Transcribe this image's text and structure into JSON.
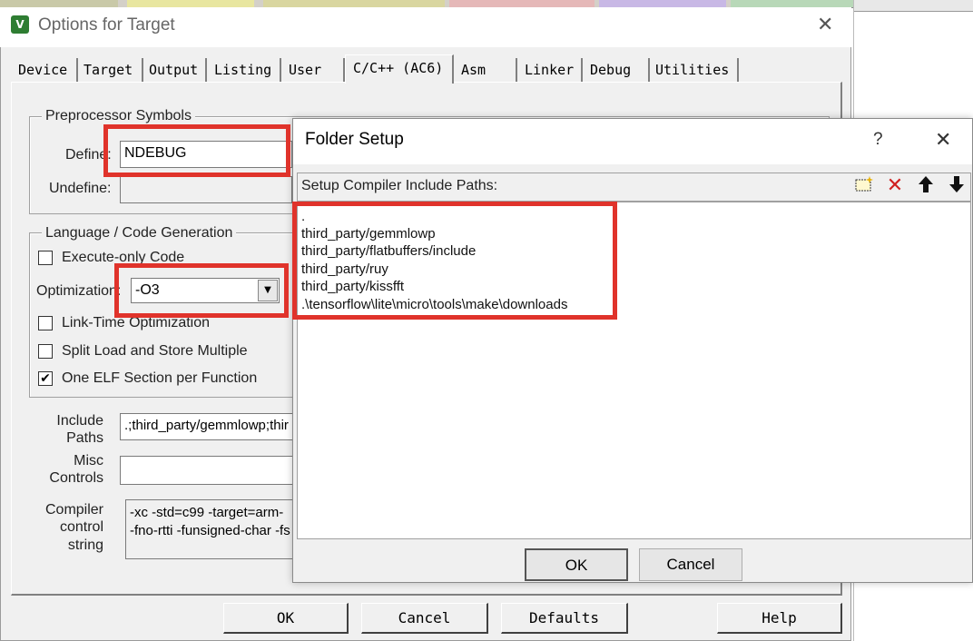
{
  "main_dialog": {
    "title": "Options for Target",
    "close_glyph": "✕",
    "tabs": [
      "Device",
      "Target",
      "Output",
      "Listing",
      "User",
      "C/C++ (AC6)",
      "Asm",
      "Linker",
      "Debug",
      "Utilities"
    ],
    "active_tab": "C/C++ (AC6)",
    "preprocessor": {
      "group_label": "Preprocessor Symbols",
      "define_label": "Define:",
      "define_value": "NDEBUG",
      "undefine_label": "Undefine:",
      "undefine_value": ""
    },
    "language": {
      "group_label": "Language / Code Generation",
      "execute_only": {
        "label": "Execute-only Code",
        "checked": false
      },
      "optimization_label": "Optimization:",
      "optimization_value": "-O3",
      "link_time": {
        "label": "Link-Time Optimization",
        "checked": false
      },
      "split_load": {
        "label": "Split Load and Store Multiple",
        "checked": false
      },
      "one_elf": {
        "label": "One ELF Section per Function",
        "checked": true
      }
    },
    "include_paths": {
      "label_1": "Include",
      "label_2": "Paths",
      "value": ".;third_party/gemmlowp;thir"
    },
    "misc_controls": {
      "label_1": "Misc",
      "label_2": "Controls",
      "value": ""
    },
    "compiler_control": {
      "label_1": "Compiler",
      "label_2": "control",
      "label_3": "string",
      "line_1": "-xc -std=c99 -target=arm-",
      "line_2": "-fno-rtti -funsigned-char -fs"
    },
    "buttons": {
      "ok": "OK",
      "cancel": "Cancel",
      "defaults": "Defaults",
      "help": "Help"
    }
  },
  "folder_setup": {
    "title": "Folder Setup",
    "help_glyph": "?",
    "close_glyph": "✕",
    "header_label": "Setup Compiler Include Paths:",
    "toolbar_icons": [
      "new-folder-icon",
      "delete-icon",
      "move-up-icon",
      "move-down-icon"
    ],
    "paths": [
      ".",
      "third_party/gemmlowp",
      "third_party/flatbuffers/include",
      "third_party/ruy",
      "third_party/kissfft",
      ".\\tensorflow\\lite\\micro\\tools\\make\\downloads"
    ],
    "buttons": {
      "ok": "OK",
      "cancel": "Cancel"
    }
  },
  "colors": {
    "highlight": "#e0332b",
    "dialog_bg": "#f0f0f0"
  }
}
